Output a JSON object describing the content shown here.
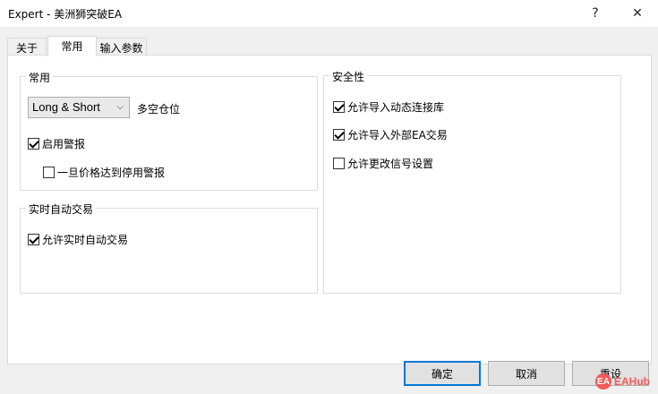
{
  "window": {
    "title": "Expert - 美洲狮突破EA",
    "help_glyph": "?",
    "close_glyph": "✕"
  },
  "tabs": [
    {
      "label": "关于"
    },
    {
      "label": "常用"
    },
    {
      "label": "输入参数"
    }
  ],
  "common_group": {
    "title": "常用",
    "position_select": {
      "value": "Long & Short",
      "label": "多空仓位"
    },
    "enable_alerts": {
      "label": "启用警报",
      "checked": true
    },
    "disable_alert_on_price": {
      "label": "一旦价格达到停用警报",
      "checked": false
    }
  },
  "live_trading_group": {
    "title": "实时自动交易",
    "allow_live_trading": {
      "label": "允许实时自动交易",
      "checked": true
    }
  },
  "security_group": {
    "title": "安全性",
    "allow_dll_import": {
      "label": "允许导入动态连接库",
      "checked": true
    },
    "allow_external_ea": {
      "label": "允许导入外部EA交易",
      "checked": true
    },
    "allow_signal_change": {
      "label": "允许更改信号设置",
      "checked": false
    }
  },
  "buttons": {
    "ok": "确定",
    "cancel": "取消",
    "reset": "重设"
  },
  "watermark": {
    "text": "EAHub",
    "logo_text": "EA"
  },
  "colors": {
    "accent": "#0078d7",
    "watermark": "#f25a5a"
  }
}
